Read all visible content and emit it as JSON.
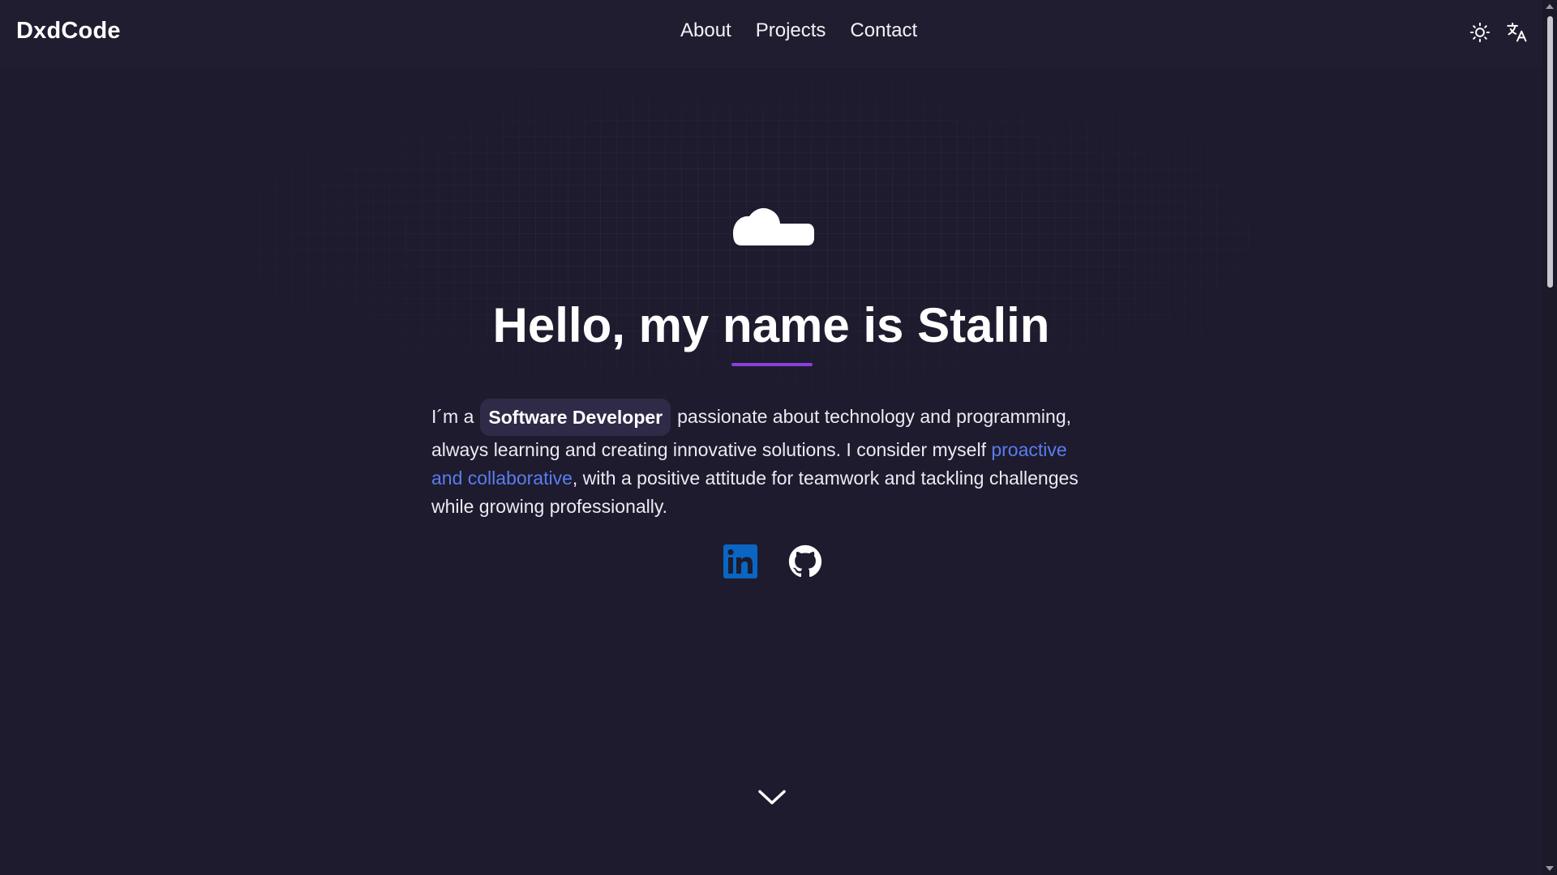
{
  "header": {
    "logo": "DxdCode",
    "nav": [
      {
        "label": "About"
      },
      {
        "label": "Projects"
      },
      {
        "label": "Contact"
      }
    ],
    "icons": [
      "sun-icon",
      "translate-icon"
    ]
  },
  "hero": {
    "title": "Hello, my name is Stalin",
    "intro_prefix": "I´m a",
    "role": "Software Developer",
    "intro_part1": "passionate about technology and programming, always learning and creating innovative solutions. I consider myself ",
    "highlight": "proactive and collaborative",
    "intro_part2": ", with a positive attitude for teamwork and tackling challenges while growing professionally."
  },
  "socials": [
    "linkedin-icon",
    "github-icon"
  ],
  "colors": {
    "background": "#1d1b2d",
    "accent": "#8b3fe0",
    "link": "#5b7cf0",
    "badge": "#2f2a47",
    "linkedin": "#0a66c2"
  }
}
